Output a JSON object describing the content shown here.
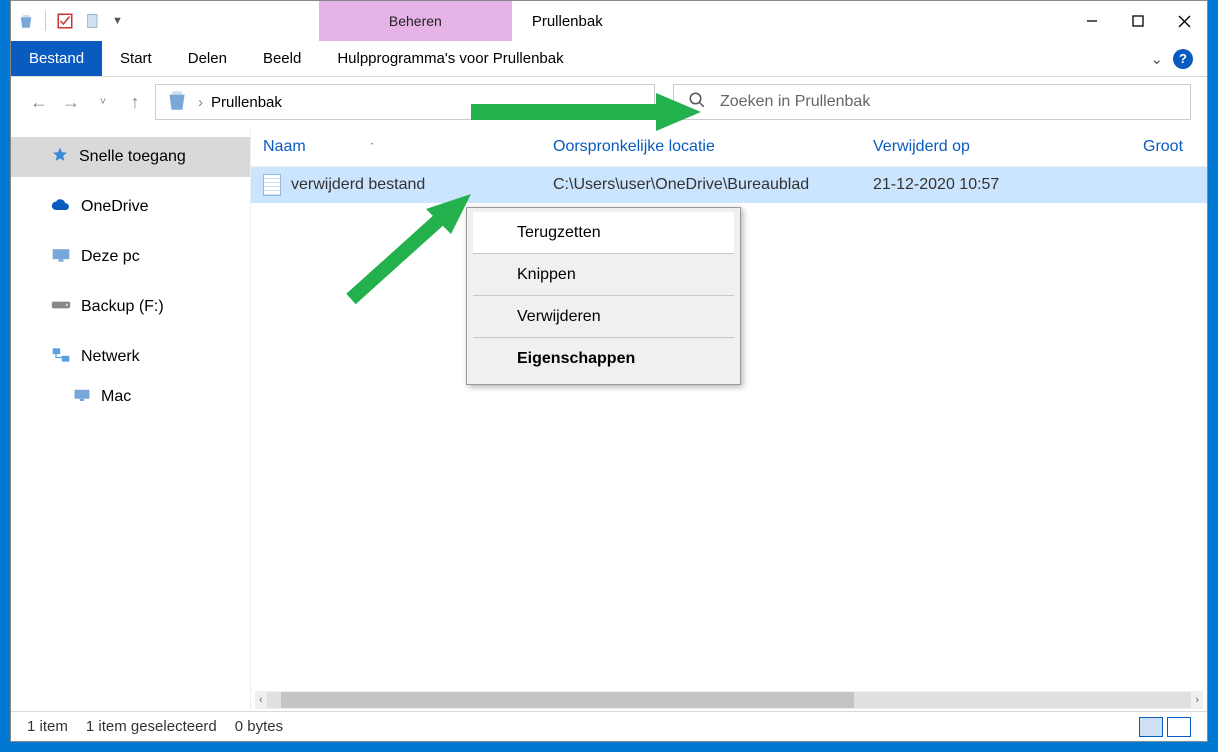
{
  "titlebar": {
    "title": "Prullenbak",
    "contextual_tab": "Beheren"
  },
  "ribbon": {
    "file": "Bestand",
    "tabs": [
      "Start",
      "Delen",
      "Beeld",
      "Hulpprogramma's voor Prullenbak"
    ]
  },
  "breadcrumb": {
    "location": "Prullenbak",
    "sep": "›"
  },
  "search": {
    "placeholder": "Zoeken in Prullenbak"
  },
  "sidebar": {
    "items": [
      {
        "label": "Snelle toegang"
      },
      {
        "label": "OneDrive"
      },
      {
        "label": "Deze pc"
      },
      {
        "label": "Backup (F:)"
      },
      {
        "label": "Netwerk"
      },
      {
        "label": "Mac"
      }
    ]
  },
  "columns": {
    "name": "Naam",
    "orig": "Oorspronkelijke locatie",
    "date": "Verwijderd op",
    "size": "Groot"
  },
  "rows": [
    {
      "name": "verwijderd bestand",
      "orig": "C:\\Users\\user\\OneDrive\\Bureaublad",
      "date": "21-12-2020 10:57"
    }
  ],
  "context_menu": [
    "Terugzetten",
    "Knippen",
    "Verwijderen",
    "Eigenschappen"
  ],
  "status": {
    "count": "1 item",
    "selected": "1 item geselecteerd",
    "size": "0 bytes"
  }
}
